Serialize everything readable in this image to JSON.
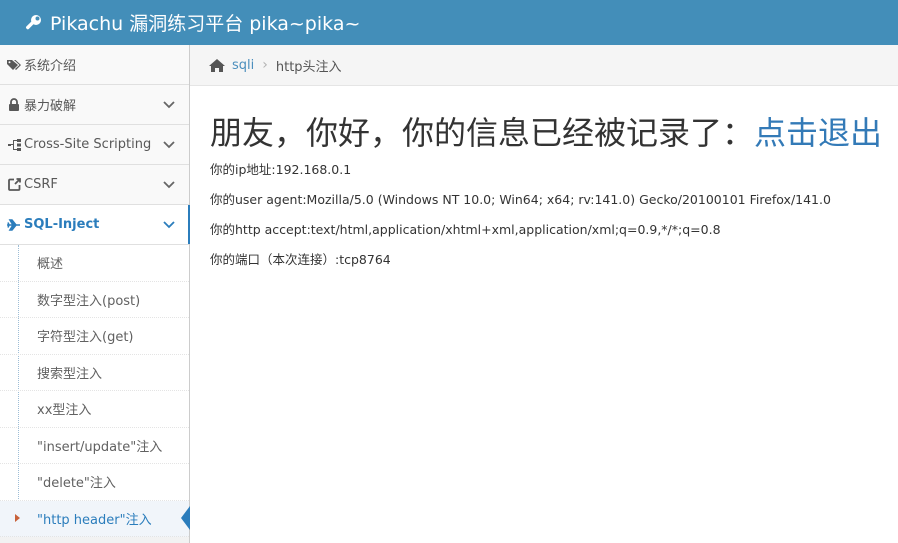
{
  "header": {
    "title": "Pikachu 漏洞练习平台 pika~pika~",
    "bg_color": "#438eb9",
    "icon": "wrench-icon"
  },
  "sidebar": {
    "items": [
      {
        "label": "系统介绍",
        "icon": "tags-icon",
        "has_chevron": false
      },
      {
        "label": "暴力破解",
        "icon": "lock-icon",
        "has_chevron": true
      },
      {
        "label": "Cross-Site Scripting",
        "icon": "sitemap-icon",
        "has_chevron": true
      },
      {
        "label": "CSRF",
        "icon": "external-link-icon",
        "has_chevron": true
      },
      {
        "label": "SQL-Inject",
        "icon": "plane-icon",
        "has_chevron": true,
        "active": true
      }
    ],
    "submenu": [
      {
        "label": "概述"
      },
      {
        "label": "数字型注入(post)"
      },
      {
        "label": "字符型注入(get)"
      },
      {
        "label": "搜索型注入"
      },
      {
        "label": "xx型注入"
      },
      {
        "label": "\"insert/update\"注入"
      },
      {
        "label": "\"delete\"注入"
      },
      {
        "label": "\"http header\"注入",
        "active": true
      }
    ],
    "accent_color": "#2b7dbc"
  },
  "breadcrumb": {
    "home_icon": "home-icon",
    "link": "sqli",
    "separator": "›",
    "current": "http头注入"
  },
  "main": {
    "headline_prefix": "朋友，你好，你的信息已经被记录了：",
    "logout_link": "点击退出",
    "info_lines": [
      "你的ip地址:192.168.0.1",
      "你的user agent:Mozilla/5.0 (Windows NT 10.0; Win64; x64; rv:141.0) Gecko/20100101 Firefox/141.0",
      "你的http accept:text/html,application/xhtml+xml,application/xml;q=0.9,*/*;q=0.8",
      "你的端口（本次连接）:tcp8764"
    ],
    "link_color": "#337ab7"
  }
}
